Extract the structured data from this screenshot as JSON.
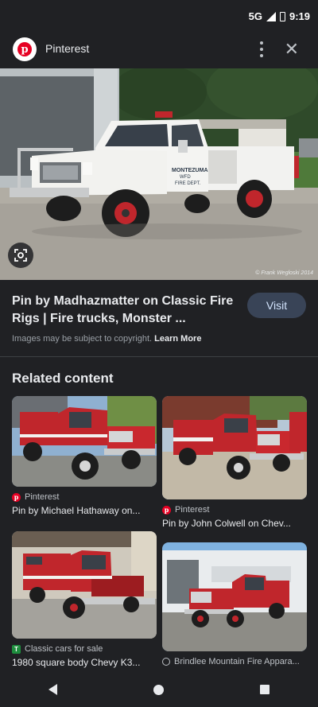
{
  "status": {
    "network": "5G",
    "time": "9:19"
  },
  "header": {
    "title": "Pinterest"
  },
  "pin": {
    "title": "Pin by Madhazmatter on Classic Fire Rigs | Fire trucks, Monster ...",
    "visit_label": "Visit",
    "copyright_text": "Images may be subject to copyright.",
    "learn_more": "Learn More",
    "watermark": "© Frank Wegloski 2014",
    "truck_door_text": "MONTEZUMA\nWFD\nFIRE DEPT."
  },
  "related": {
    "heading": "Related content",
    "items": [
      {
        "source": "Pinterest",
        "source_icon": "pinterest-icon",
        "title": "Pin by Michael Hathaway on..."
      },
      {
        "source": "Pinterest",
        "source_icon": "pinterest-icon",
        "title": "Pin by John Colwell on Chev..."
      },
      {
        "source": "Classic cars for sale",
        "source_icon": "classic-cars-icon",
        "title": "1980 square body Chevy K3..."
      },
      {
        "source": "Brindlee Mountain Fire Appara...",
        "source_icon": "globe-icon",
        "title": ""
      }
    ]
  },
  "colors": {
    "background": "#202124",
    "visit_button": "#394457",
    "truck_red": "#c0262c",
    "pinterest_red": "#e60023"
  }
}
